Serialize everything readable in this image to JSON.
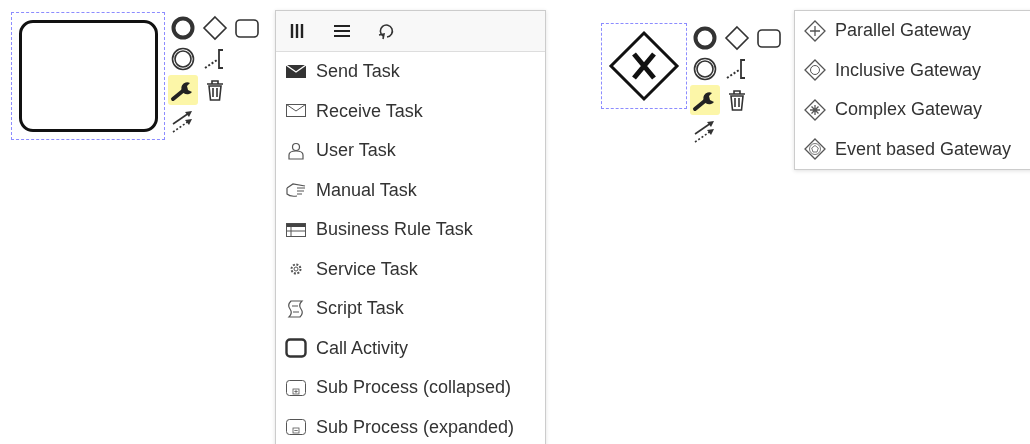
{
  "shapes": [
    {
      "kind": "task",
      "pad": [
        {
          "kind": "end-event",
          "selected": false
        },
        {
          "kind": "gateway",
          "selected": false
        },
        {
          "kind": "task",
          "selected": false
        },
        {
          "kind": "intermediate-event",
          "selected": false
        },
        {
          "kind": "text-annotation",
          "selected": false
        },
        {
          "kind": "replace",
          "selected": true
        },
        {
          "kind": "delete",
          "selected": false
        },
        {
          "kind": "connect",
          "selected": false
        }
      ],
      "menu": {
        "header_tools": [
          {
            "kind": "columns"
          },
          {
            "kind": "lines"
          },
          {
            "kind": "loop"
          }
        ],
        "items": [
          {
            "label": "Send Task",
            "kind": "send"
          },
          {
            "label": "Receive Task",
            "kind": "receive"
          },
          {
            "label": "User Task",
            "kind": "user"
          },
          {
            "label": "Manual Task",
            "kind": "manual"
          },
          {
            "label": "Business Rule Task",
            "kind": "business-rule"
          },
          {
            "label": "Service Task",
            "kind": "service"
          },
          {
            "label": "Script Task",
            "kind": "script"
          },
          {
            "label": "Call Activity",
            "kind": "call-activity"
          },
          {
            "label": "Sub Process (collapsed)",
            "kind": "subprocess-collapsed"
          },
          {
            "label": "Sub Process (expanded)",
            "kind": "subprocess-expanded"
          }
        ]
      }
    },
    {
      "kind": "exclusive-gateway",
      "pad": [
        {
          "kind": "end-event",
          "selected": false
        },
        {
          "kind": "gateway",
          "selected": false
        },
        {
          "kind": "task",
          "selected": false
        },
        {
          "kind": "intermediate-event",
          "selected": false
        },
        {
          "kind": "text-annotation",
          "selected": false
        },
        {
          "kind": "replace",
          "selected": true
        },
        {
          "kind": "delete",
          "selected": false
        },
        {
          "kind": "connect",
          "selected": false
        }
      ],
      "menu": {
        "items": [
          {
            "label": "Parallel Gateway",
            "kind": "parallel-gateway"
          },
          {
            "label": "Inclusive Gateway",
            "kind": "inclusive-gateway"
          },
          {
            "label": "Complex Gateway",
            "kind": "complex-gateway"
          },
          {
            "label": "Event based Gateway",
            "kind": "event-gateway"
          }
        ]
      }
    }
  ]
}
